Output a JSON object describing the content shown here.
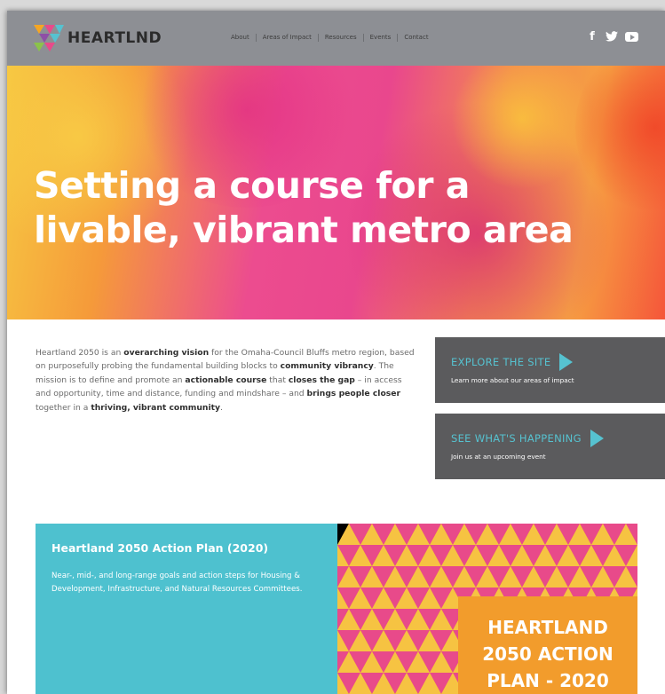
{
  "header": {
    "logo_text": "HEARTLND",
    "nav": [
      "About",
      "Areas of Impact",
      "Resources",
      "Events",
      "Contact"
    ],
    "social": [
      "facebook-icon",
      "twitter-icon",
      "youtube-icon"
    ],
    "background": "#8d8f94"
  },
  "hero": {
    "title": "Setting a course for a livable, vibrant metro area"
  },
  "intro": {
    "p1": "Heartland 2050 is an ",
    "b1": "overarching vision",
    "p2": " for the Omaha-Council Bluffs metro region, based on purposefully probing the fundamental building blocks to ",
    "b2": "community vibrancy",
    "p3": ". The mission is to define and promote an ",
    "b3": "actionable course",
    "p4": " that ",
    "b4": "closes the gap",
    "p5": " – in access and opportunity, time and distance, funding and mindshare – and ",
    "b5": "brings people closer",
    "p6": " together in a ",
    "b6": "thriving, vibrant community",
    "p7": "."
  },
  "cta": [
    {
      "title": "EXPLORE THE SITE",
      "subtitle": "Learn more about our areas of impact"
    },
    {
      "title": "SEE WHAT'S HAPPENING",
      "subtitle": "Join us at an upcoming event"
    }
  ],
  "plan": {
    "title": "Heartland 2050 Action Plan (2020)",
    "description": "Near-, mid-, and long-range goals and action steps for Housing & Development, Infrastructure, and Natural Resources Committees.",
    "badge_lines": [
      "HEARTLAND",
      "2050 ACTION",
      "PLAN - 2020"
    ]
  },
  "colors": {
    "accent": "#56c2d0",
    "cta_bg": "#5b5b5d",
    "plan_teal": "#4ec1cf",
    "plan_orange": "#f29c2c"
  }
}
